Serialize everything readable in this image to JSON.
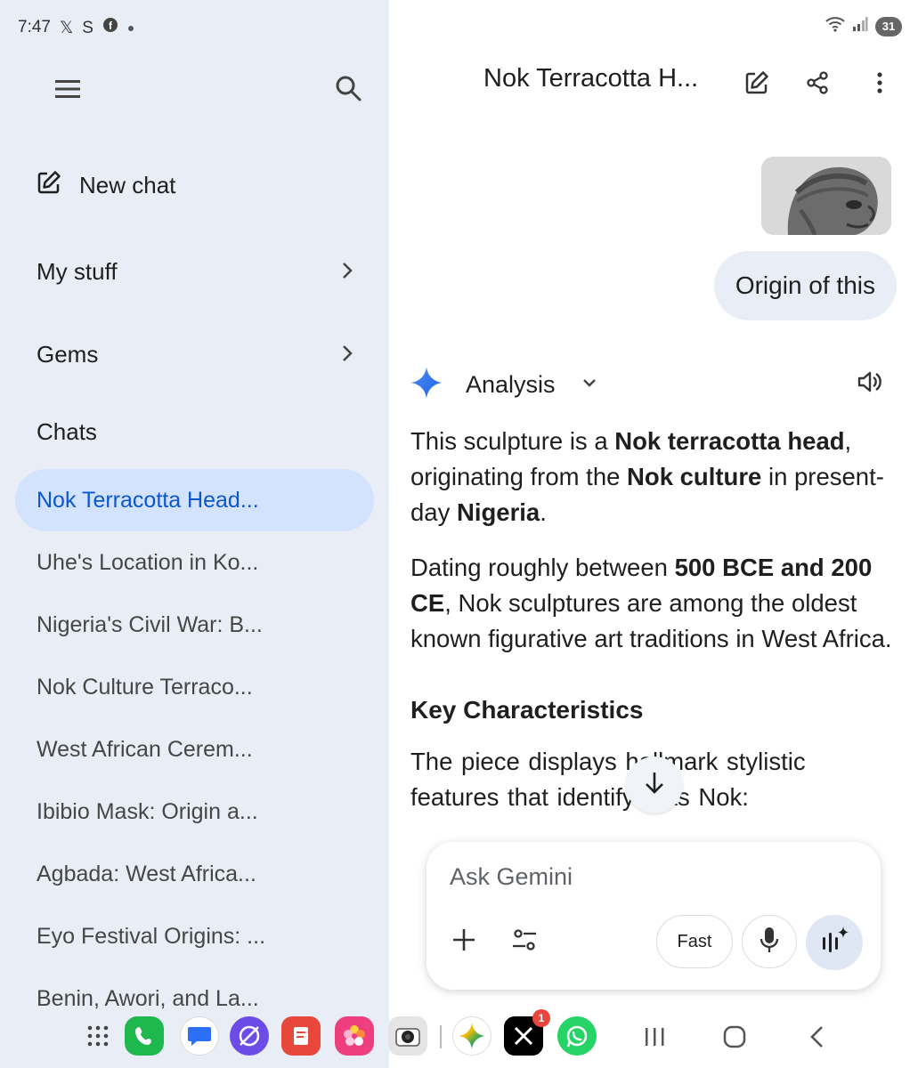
{
  "status_bar": {
    "time": "7:47",
    "notification_icons": [
      "x-icon",
      "s-icon",
      "facebook-icon",
      "dot-icon"
    ],
    "battery": "31"
  },
  "drawer": {
    "new_chat_label": "New chat",
    "my_stuff_label": "My stuff",
    "gems_label": "Gems",
    "chats_heading": "Chats",
    "chats": [
      "Nok Terracotta Head...",
      "Uhe's Location in Ko...",
      "Nigeria's Civil War: B...",
      "Nok Culture Terraco...",
      "West African Cerem...",
      "Ibibio Mask: Origin a...",
      "Agbada: West Africa...",
      "Eyo Festival Origins: ...",
      "Benin, Awori, and La..."
    ]
  },
  "topbar": {
    "title": "Nok Terracotta H..."
  },
  "conversation": {
    "user_message": "Origin of this",
    "response_mode": "Analysis",
    "p1": {
      "a": "This sculpture is a ",
      "b": "Nok terracotta head",
      "c": ", originating from the ",
      "d": "Nok culture",
      "e": " in present-day ",
      "f": "Nigeria",
      "g": "."
    },
    "p2": {
      "a": "Dating roughly between ",
      "b": "500 BCE and 200 CE",
      "c": ", Nok sculptures are among the oldest known figurative art traditions in West Africa."
    },
    "heading": "Key Characteristics",
    "p3": "The piece displays hallmark stylistic features that identify it as Nok:"
  },
  "input": {
    "placeholder": "Ask Gemini",
    "mode_label": "Fast"
  },
  "dock": {
    "apps": [
      "apps-grid-icon",
      "phone-icon",
      "messages-icon",
      "internet-icon",
      "notes-icon",
      "gallery-icon",
      "camera-icon",
      "gemini-icon",
      "x-app-icon",
      "whatsapp-icon"
    ],
    "x_badge": "1"
  },
  "colors": {
    "drawer_bg": "#e9eef6",
    "active_chat_bg": "#d3e3fd",
    "active_chat_text": "#0b57d0",
    "user_bubble_bg": "#e9eef6"
  }
}
